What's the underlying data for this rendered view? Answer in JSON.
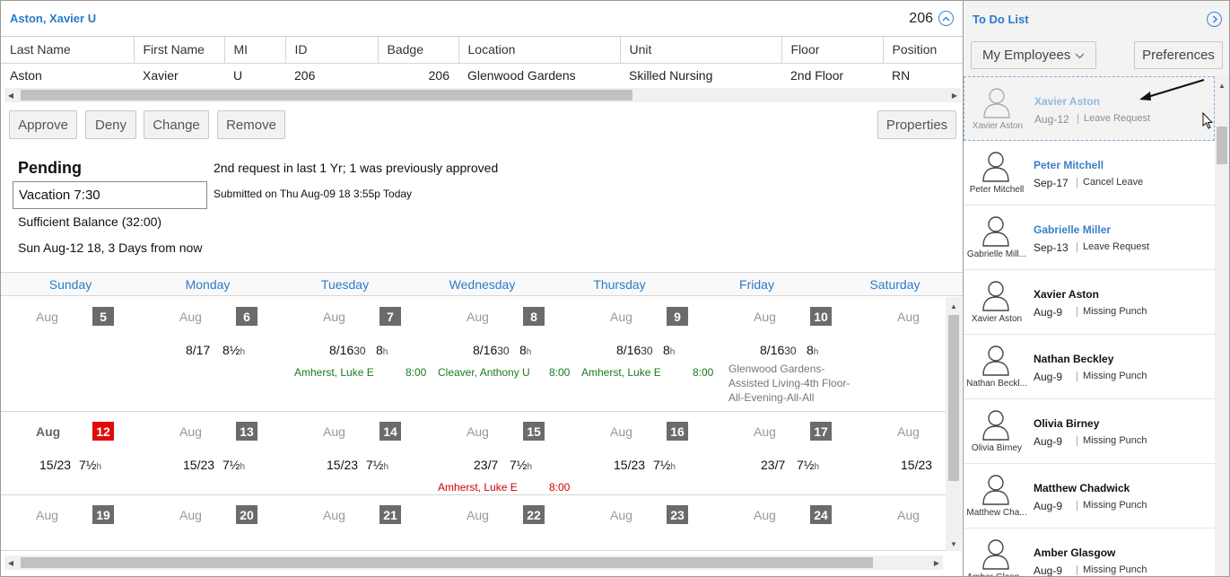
{
  "header": {
    "name": "Aston, Xavier U",
    "id": "206"
  },
  "employee_table": {
    "columns": [
      "Last Name",
      "First Name",
      "MI",
      "ID",
      "Badge",
      "Location",
      "Unit",
      "Floor",
      "Position"
    ],
    "row": [
      "Aston",
      "Xavier",
      "U",
      "206",
      "206",
      "Glenwood Gardens",
      "Skilled Nursing",
      "2nd Floor",
      "RN"
    ]
  },
  "actions": {
    "approve": "Approve",
    "deny": "Deny",
    "change": "Change",
    "remove": "Remove",
    "properties": "Properties"
  },
  "request": {
    "status": "Pending",
    "type": "Vacation 7:30",
    "balance": "Sufficient Balance (32:00)",
    "date": "Sun Aug-12 18, 3 Days from now",
    "history": "2nd request in last 1 Yr; 1 was previously approved",
    "submitted": "Submitted on Thu Aug-09 18 3:55p Today"
  },
  "calendar": {
    "days": [
      "Sunday",
      "Monday",
      "Tuesday",
      "Wednesday",
      "Thursday",
      "Friday",
      "Saturday"
    ],
    "weeks": [
      [
        {
          "month": "Aug",
          "day": "5"
        },
        {
          "month": "Aug",
          "day": "6",
          "shift_a": "8/17",
          "shift_b": "",
          "hours": "8½",
          "unit": "h"
        },
        {
          "month": "Aug",
          "day": "7",
          "shift_a": "8/16",
          "shift_b": "30",
          "hours": "8",
          "unit": "h",
          "assign_name": "Amherst, Luke E",
          "assign_time": "8:00"
        },
        {
          "month": "Aug",
          "day": "8",
          "shift_a": "8/16",
          "shift_b": "30",
          "hours": "8",
          "unit": "h",
          "assign_name": "Cleaver, Anthony U",
          "assign_time": "8:00"
        },
        {
          "month": "Aug",
          "day": "9",
          "shift_a": "8/16",
          "shift_b": "30",
          "hours": "8",
          "unit": "h",
          "assign_name": "Amherst, Luke E",
          "assign_time": "8:00"
        },
        {
          "month": "Aug",
          "day": "10",
          "shift_a": "8/16",
          "shift_b": "30",
          "hours": "8",
          "unit": "h",
          "location": [
            "Glenwood Gardens-",
            "Assisted Living-4th Floor-",
            "All-Evening-All-All"
          ]
        },
        {
          "month": "Aug",
          "day": ""
        }
      ],
      [
        {
          "month": "Aug",
          "day": "12",
          "today": true,
          "shift_a": "15/23",
          "hours": "7½",
          "unit": "h"
        },
        {
          "month": "Aug",
          "day": "13",
          "shift_a": "15/23",
          "hours": "7½",
          "unit": "h"
        },
        {
          "month": "Aug",
          "day": "14",
          "shift_a": "15/23",
          "hours": "7½",
          "unit": "h"
        },
        {
          "month": "Aug",
          "day": "15",
          "shift_a": "23/7",
          "hours": "7½",
          "unit": "h",
          "assign_name": "Amherst, Luke E",
          "assign_time": "8:00",
          "red": true
        },
        {
          "month": "Aug",
          "day": "16",
          "shift_a": "15/23",
          "hours": "7½",
          "unit": "h"
        },
        {
          "month": "Aug",
          "day": "17",
          "shift_a": "23/7",
          "hours": "7½",
          "unit": "h"
        },
        {
          "month": "Aug",
          "day": "",
          "shift_a": "15/23"
        }
      ],
      [
        {
          "month": "Aug",
          "day": "19"
        },
        {
          "month": "Aug",
          "day": "20"
        },
        {
          "month": "Aug",
          "day": "21"
        },
        {
          "month": "Aug",
          "day": "22"
        },
        {
          "month": "Aug",
          "day": "23"
        },
        {
          "month": "Aug",
          "day": "24"
        },
        {
          "month": "Aug",
          "day": ""
        }
      ]
    ]
  },
  "todo": {
    "title": "To Do List",
    "filter": "My Employees",
    "preferences": "Preferences",
    "items": [
      {
        "name": "Xavier Aston",
        "avatar_label": "Xavier Aston",
        "date": "Aug-12",
        "type": "Leave Request",
        "link": true,
        "dragging": true
      },
      {
        "name": "Peter Mitchell",
        "avatar_label": "Peter Mitchell",
        "date": "Sep-17",
        "type": "Cancel Leave",
        "link": true
      },
      {
        "name": "Gabrielle Miller",
        "avatar_label": "Gabrielle Mill...",
        "date": "Sep-13",
        "type": "Leave Request",
        "link": true
      },
      {
        "name": "Xavier Aston",
        "avatar_label": "Xavier Aston",
        "date": "Aug-9",
        "type": "Missing Punch"
      },
      {
        "name": "Nathan Beckley",
        "avatar_label": "Nathan Beckl...",
        "date": "Aug-9",
        "type": "Missing Punch"
      },
      {
        "name": "Olivia Birney",
        "avatar_label": "Olivia Birney",
        "date": "Aug-9",
        "type": "Missing Punch"
      },
      {
        "name": "Matthew Chadwick",
        "avatar_label": "Matthew Cha...",
        "date": "Aug-9",
        "type": "Missing Punch"
      },
      {
        "name": "Amber Glasgow",
        "avatar_label": "Amber Glasg...",
        "date": "Aug-9",
        "type": "Missing Punch"
      }
    ]
  }
}
